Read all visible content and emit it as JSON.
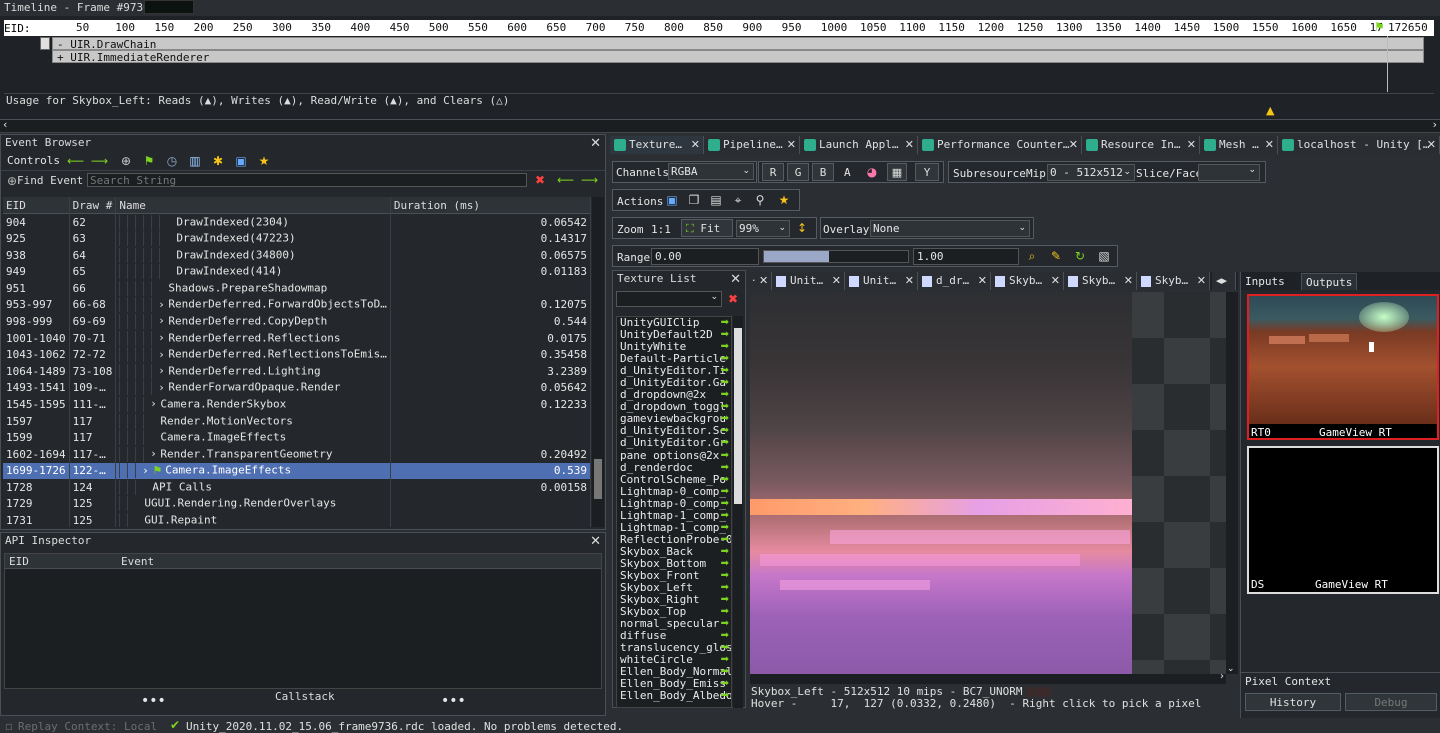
{
  "timeline": {
    "title": "Timeline - Frame #9736",
    "eid_label": "EID:",
    "ticks": [
      "50",
      "100",
      "150",
      "200",
      "250",
      "300",
      "350",
      "400",
      "450",
      "500",
      "550",
      "600",
      "650",
      "700",
      "750",
      "800",
      "850",
      "900",
      "950",
      "1000",
      "1050",
      "1100",
      "1150",
      "1200",
      "1250",
      "1300",
      "1350",
      "1400",
      "1450",
      "1500",
      "1550",
      "1600",
      "1650",
      "17",
      "172650"
    ],
    "rows": [
      "- UIR.DrawChain",
      "+ UIR.ImmediateRenderer"
    ],
    "usage": "Usage for Skybox_Left: Reads (▲), Writes (▲), Read/Write (▲), and Clears (△)"
  },
  "event_browser": {
    "title": "Event Browser",
    "controls_label": "Controls",
    "find_label": "Find Event",
    "search_placeholder": "Search String",
    "columns": [
      "EID",
      "Draw #",
      "Name",
      "Duration (ms)"
    ],
    "rows": [
      {
        "eid": "904",
        "draw": "62",
        "name": "DrawIndexed(2304)",
        "dur": "0.06542",
        "indent": 6,
        "exp": ""
      },
      {
        "eid": "925",
        "draw": "63",
        "name": "DrawIndexed(47223)",
        "dur": "0.14317",
        "indent": 6,
        "exp": ""
      },
      {
        "eid": "938",
        "draw": "64",
        "name": "DrawIndexed(34800)",
        "dur": "0.06575",
        "indent": 6,
        "exp": ""
      },
      {
        "eid": "949",
        "draw": "65",
        "name": "DrawIndexed(414)",
        "dur": "0.01183",
        "indent": 6,
        "exp": ""
      },
      {
        "eid": "951",
        "draw": "66",
        "name": "Shadows.PrepareShadowmap",
        "dur": "",
        "indent": 5,
        "exp": ""
      },
      {
        "eid": "953-997",
        "draw": "66-68",
        "name": "RenderDeferred.ForwardObjectsToD…",
        "dur": "0.12075",
        "indent": 5,
        "exp": "›"
      },
      {
        "eid": "998-999",
        "draw": "69-69",
        "name": "RenderDeferred.CopyDepth",
        "dur": "0.544",
        "indent": 5,
        "exp": "›"
      },
      {
        "eid": "1001-1040",
        "draw": "70-71",
        "name": "RenderDeferred.Reflections",
        "dur": "0.0175",
        "indent": 5,
        "exp": "›"
      },
      {
        "eid": "1043-1062",
        "draw": "72-72",
        "name": "RenderDeferred.ReflectionsToEmis…",
        "dur": "0.35458",
        "indent": 5,
        "exp": "›"
      },
      {
        "eid": "1064-1489",
        "draw": "73-108",
        "name": "RenderDeferred.Lighting",
        "dur": "3.2389",
        "indent": 5,
        "exp": "›"
      },
      {
        "eid": "1493-1541",
        "draw": "109-…",
        "name": "RenderForwardOpaque.Render",
        "dur": "0.05642",
        "indent": 5,
        "exp": "›"
      },
      {
        "eid": "1545-1595",
        "draw": "111-…",
        "name": "Camera.RenderSkybox",
        "dur": "0.12233",
        "indent": 4,
        "exp": "›"
      },
      {
        "eid": "1597",
        "draw": "117",
        "name": "Render.MotionVectors",
        "dur": "",
        "indent": 4,
        "exp": ""
      },
      {
        "eid": "1599",
        "draw": "117",
        "name": "Camera.ImageEffects",
        "dur": "",
        "indent": 4,
        "exp": ""
      },
      {
        "eid": "1602-1694",
        "draw": "117-…",
        "name": "Render.TransparentGeometry",
        "dur": "0.20492",
        "indent": 4,
        "exp": "›"
      },
      {
        "eid": "1699-1726",
        "draw": "122-…",
        "name": "Camera.ImageEffects",
        "dur": "0.539",
        "indent": 3,
        "exp": "›",
        "sel": true
      },
      {
        "eid": "1728",
        "draw": "124",
        "name": "API Calls",
        "dur": "0.00158",
        "indent": 3,
        "exp": ""
      },
      {
        "eid": "1729",
        "draw": "125",
        "name": "UGUI.Rendering.RenderOverlays",
        "dur": "",
        "indent": 2,
        "exp": ""
      },
      {
        "eid": "1731",
        "draw": "125",
        "name": "GUI.Repaint",
        "dur": "",
        "indent": 2,
        "exp": ""
      }
    ]
  },
  "api_inspector": {
    "title": "API Inspector",
    "columns": [
      "EID",
      "Event"
    ],
    "callstack": "Callstack"
  },
  "status": {
    "replay": "Replay Context: Local",
    "message": "Unity_2020.11.02_15.06_frame9736.rdc loaded. No problems detected."
  },
  "texture_viewer": {
    "tabs": [
      "Texture…",
      "Pipeline…",
      "Launch Appl…",
      "Performance Counter…",
      "Resource In…",
      "Mesh …",
      "localhost - Unity […"
    ],
    "channels_label": "Channels",
    "channels_value": "RGBA",
    "channel_buttons": [
      "R",
      "G",
      "B",
      "A"
    ],
    "subresource_label": "Subresource",
    "mip_label": "Mip",
    "mip_value": "0 - 512x512",
    "slice_label": "Slice/Face",
    "actions_label": "Actions",
    "zoom_label": "Zoom",
    "zoom_1to1": "1:1",
    "fit_label": "Fit",
    "zoom_value": "99%",
    "overlay_label": "Overlay",
    "overlay_value": "None",
    "range_label": "Range",
    "range_min": "0.00",
    "range_max": "1.00",
    "range_fill": 0.45,
    "texture_list_title": "Texture List",
    "textures": [
      "UnityGUIClip",
      "UnityDefault2D",
      "UnityWhite",
      "Default-Particle",
      "d_UnityEditor.Ti",
      "d_UnityEditor.Ga",
      "d_dropdown@2x",
      "d_dropdown_toggl",
      "gameviewbackgrou",
      "d_UnityEditor.Sc",
      "d_UnityEditor.Gr",
      "pane options@2x",
      "d_renderdoc",
      "ControlScheme_Po",
      "Lightmap-0_comp_",
      "Lightmap-0_comp_",
      "Lightmap-1_comp_",
      "Lightmap-1_comp_",
      "ReflectionProbe-0",
      "Skybox_Back",
      "Skybox_Bottom",
      "Skybox_Front",
      "Skybox_Left",
      "Skybox_Right",
      "Skybox_Top",
      "normal_specular",
      "diffuse",
      "translucency_glos",
      "whiteCircle",
      "Ellen_Body_Normal",
      "Ellen_Body_Emiss",
      "Ellen_Body_Albedo"
    ],
    "view_tabs": [
      "Unit…",
      "Unit…",
      "d_dr…",
      "Skyb…",
      "Skyb…",
      "Skyb…"
    ],
    "info_line": "Skybox_Left - 512x512 10 mips - BC7_UNORM",
    "hover_line": "Hover -     17,  127 (0.0332, 0.2480)  - Right click to pick a pixel",
    "io_tabs": [
      "Inputs",
      "Outputs"
    ],
    "thumbs": [
      {
        "slot": "RT0",
        "name": "GameView RT"
      },
      {
        "slot": "DS",
        "name": "GameView RT"
      }
    ],
    "pixel_context": "Pixel Context",
    "history_label": "History",
    "debug_label": "Debug"
  }
}
